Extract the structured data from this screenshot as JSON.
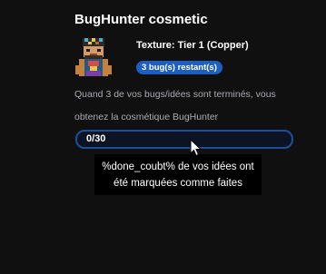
{
  "card": {
    "title": "BugHunter cosmetic",
    "avatar_icon": "pixel-character-avatar-icon",
    "texture_label": "Texture: Tier 1 (Copper)",
    "remaining_badge": "3 bug(s) restant(s)",
    "description": "Quand 3 de vos bugs/idées sont terminés, vous obtenez la cosmétique BugHunter"
  },
  "progress": {
    "label": "0/30",
    "value": 0,
    "max": 30
  },
  "tooltip": {
    "text": "%done_coubt% de vos idées ont été marquées comme faites"
  },
  "colors": {
    "background": "#101011",
    "accent": "#1d5fc0",
    "progress_border": "#1e4f9a",
    "muted_text": "#a9abb1"
  },
  "cursor_icon": "arrow-cursor-icon"
}
